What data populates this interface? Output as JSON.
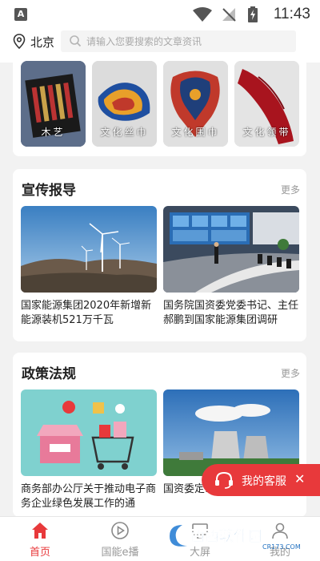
{
  "status_bar": {
    "time": "11:43",
    "app_badge": "A"
  },
  "location": {
    "city": "北京"
  },
  "search": {
    "placeholder": "请输入您要搜索的文章资讯"
  },
  "products": [
    {
      "label": "木艺"
    },
    {
      "label": "文化丝巾"
    },
    {
      "label": "文化围巾"
    },
    {
      "label": "文化领带"
    }
  ],
  "sections": {
    "promo": {
      "title": "宣传报导",
      "more": "更多",
      "articles": [
        {
          "title": "国家能源集团2020年新增新能源装机521万千瓦"
        },
        {
          "title": "国务院国资委党委书记、主任郝鹏到国家能源集团调研"
        }
      ]
    },
    "policy": {
      "title": "政策法规",
      "more": "更多",
      "articles": [
        {
          "title": "商务部办公厅关于推动电子商务企业绿色发展工作的通"
        },
        {
          "title": "国资委定……大重点任务"
        }
      ]
    }
  },
  "customer_service": {
    "label": "我的客服"
  },
  "tabbar": {
    "items": [
      {
        "label": "首页",
        "icon": "home-icon",
        "active": true
      },
      {
        "label": "国能e播",
        "icon": "play-icon",
        "active": false
      },
      {
        "label": "大屏",
        "icon": "screen-icon",
        "active": false
      },
      {
        "label": "我的",
        "icon": "user-icon",
        "active": false
      }
    ]
  },
  "watermark": {
    "text": "西西软件园",
    "sub": "CR173.COM"
  },
  "colors": {
    "accent": "#e8393b",
    "background": "#f2f2f2"
  }
}
